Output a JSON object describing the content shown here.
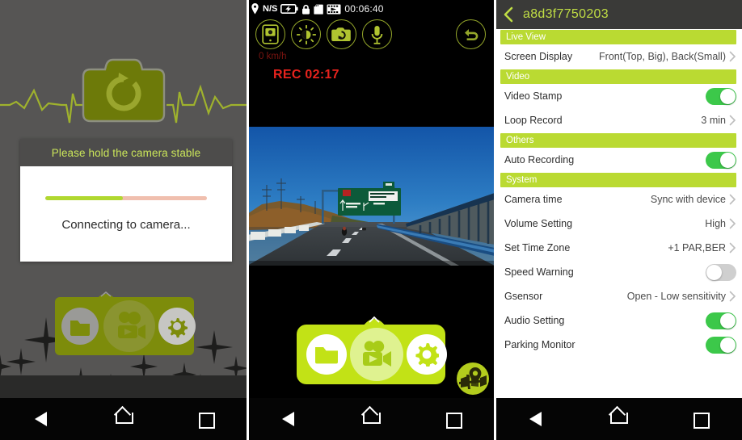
{
  "colors": {
    "brand_green": "#bada32",
    "brand_green_bright": "#c2e216",
    "olive": "#7d8c0b",
    "title_text_green": "#c0dd44",
    "toggle_on": "#3cc84a",
    "toggle_off": "#cfcfcf",
    "rec_red": "#e8231d",
    "splash_bg": "#565554",
    "titlebar_bg": "#3a3a38",
    "progress_fill": "#b0d830",
    "progress_track": "#f0bfae"
  },
  "panel_connecting": {
    "name": "connecting-splash-screen",
    "logo_icon": "camera-refresh-icon",
    "background_icon": "heartbeat-line-icon",
    "dialog": {
      "title": "Please hold the camera stable",
      "message": "Connecting to camera...",
      "progress_percent": 48
    },
    "toolbar": {
      "buttons": [
        {
          "icon": "folder-icon",
          "name": "files-button"
        },
        {
          "icon": "video-camera-icon",
          "name": "record-button"
        },
        {
          "icon": "gear-icon",
          "name": "settings-button"
        }
      ],
      "caret_icon": "chevron-up-icon"
    },
    "navbar": {
      "back": "back-triangle-icon",
      "home": "home-icon",
      "recent": "recents-square-icon"
    }
  },
  "panel_liveview": {
    "name": "live-view-screen",
    "statusbar": {
      "gps_icon": "location-pin-icon",
      "gps_label": "N/S",
      "battery_icon": "battery-charging-icon",
      "lock_icon": "lock-icon",
      "sdcard_icon": "sd-card-icon",
      "film_icon": "film-strip-icon",
      "time": "00:06:40"
    },
    "controls": [
      {
        "icon": "snapshot-to-phone-icon",
        "name": "snapshot-to-phone-button"
      },
      {
        "icon": "brightness-icon",
        "name": "brightness-button"
      },
      {
        "icon": "switch-camera-icon",
        "name": "switch-camera-button"
      },
      {
        "icon": "microphone-icon",
        "name": "microphone-button"
      }
    ],
    "back_button_icon": "return-arrow-icon",
    "overlay": {
      "speed": "0 km/h",
      "recording": "REC 02:17"
    },
    "video": {
      "description": "dashcam highway view with green overhead road sign and blue noise barrier"
    },
    "bottombar": {
      "caret_icon": "chevron-up-icon",
      "buttons": [
        {
          "icon": "folder-icon",
          "name": "files-button"
        },
        {
          "icon": "video-camera-icon",
          "name": "record-button"
        },
        {
          "icon": "gear-icon",
          "name": "settings-button"
        }
      ]
    },
    "map_button_icon": "map-pin-icon",
    "navbar": {
      "back": "back-triangle-icon",
      "home": "home-icon",
      "recent": "recents-square-icon"
    }
  },
  "panel_settings": {
    "name": "settings-screen",
    "titlebar": {
      "back_icon": "chevron-left-icon",
      "title": "a8d3f7750203"
    },
    "sections": [
      {
        "header": "Live View",
        "rows": [
          {
            "label": "Screen Display",
            "type": "value",
            "value": "Front(Top, Big), Back(Small)"
          }
        ]
      },
      {
        "header": "Video",
        "rows": [
          {
            "label": "Video Stamp",
            "type": "toggle",
            "state": "on"
          },
          {
            "label": "Loop Record",
            "type": "value",
            "value": "3 min"
          }
        ]
      },
      {
        "header": "Others",
        "rows": [
          {
            "label": "Auto Recording",
            "type": "toggle",
            "state": "on"
          }
        ]
      },
      {
        "header": "System",
        "rows": [
          {
            "label": "Camera time",
            "type": "value",
            "value": "Sync with device"
          },
          {
            "label": "Volume Setting",
            "type": "value",
            "value": "High"
          },
          {
            "label": "Set Time Zone",
            "type": "value",
            "value": "+1 PAR,BER"
          },
          {
            "label": "Speed Warning",
            "type": "toggle",
            "state": "off"
          },
          {
            "label": "Gsensor",
            "type": "value",
            "value": "Open - Low sensitivity"
          },
          {
            "label": "Audio Setting",
            "type": "toggle",
            "state": "on"
          },
          {
            "label": "Parking Monitor",
            "type": "toggle",
            "state": "on"
          }
        ]
      }
    ],
    "navbar": {
      "back": "back-triangle-icon",
      "home": "home-icon",
      "recent": "recents-square-icon"
    }
  }
}
